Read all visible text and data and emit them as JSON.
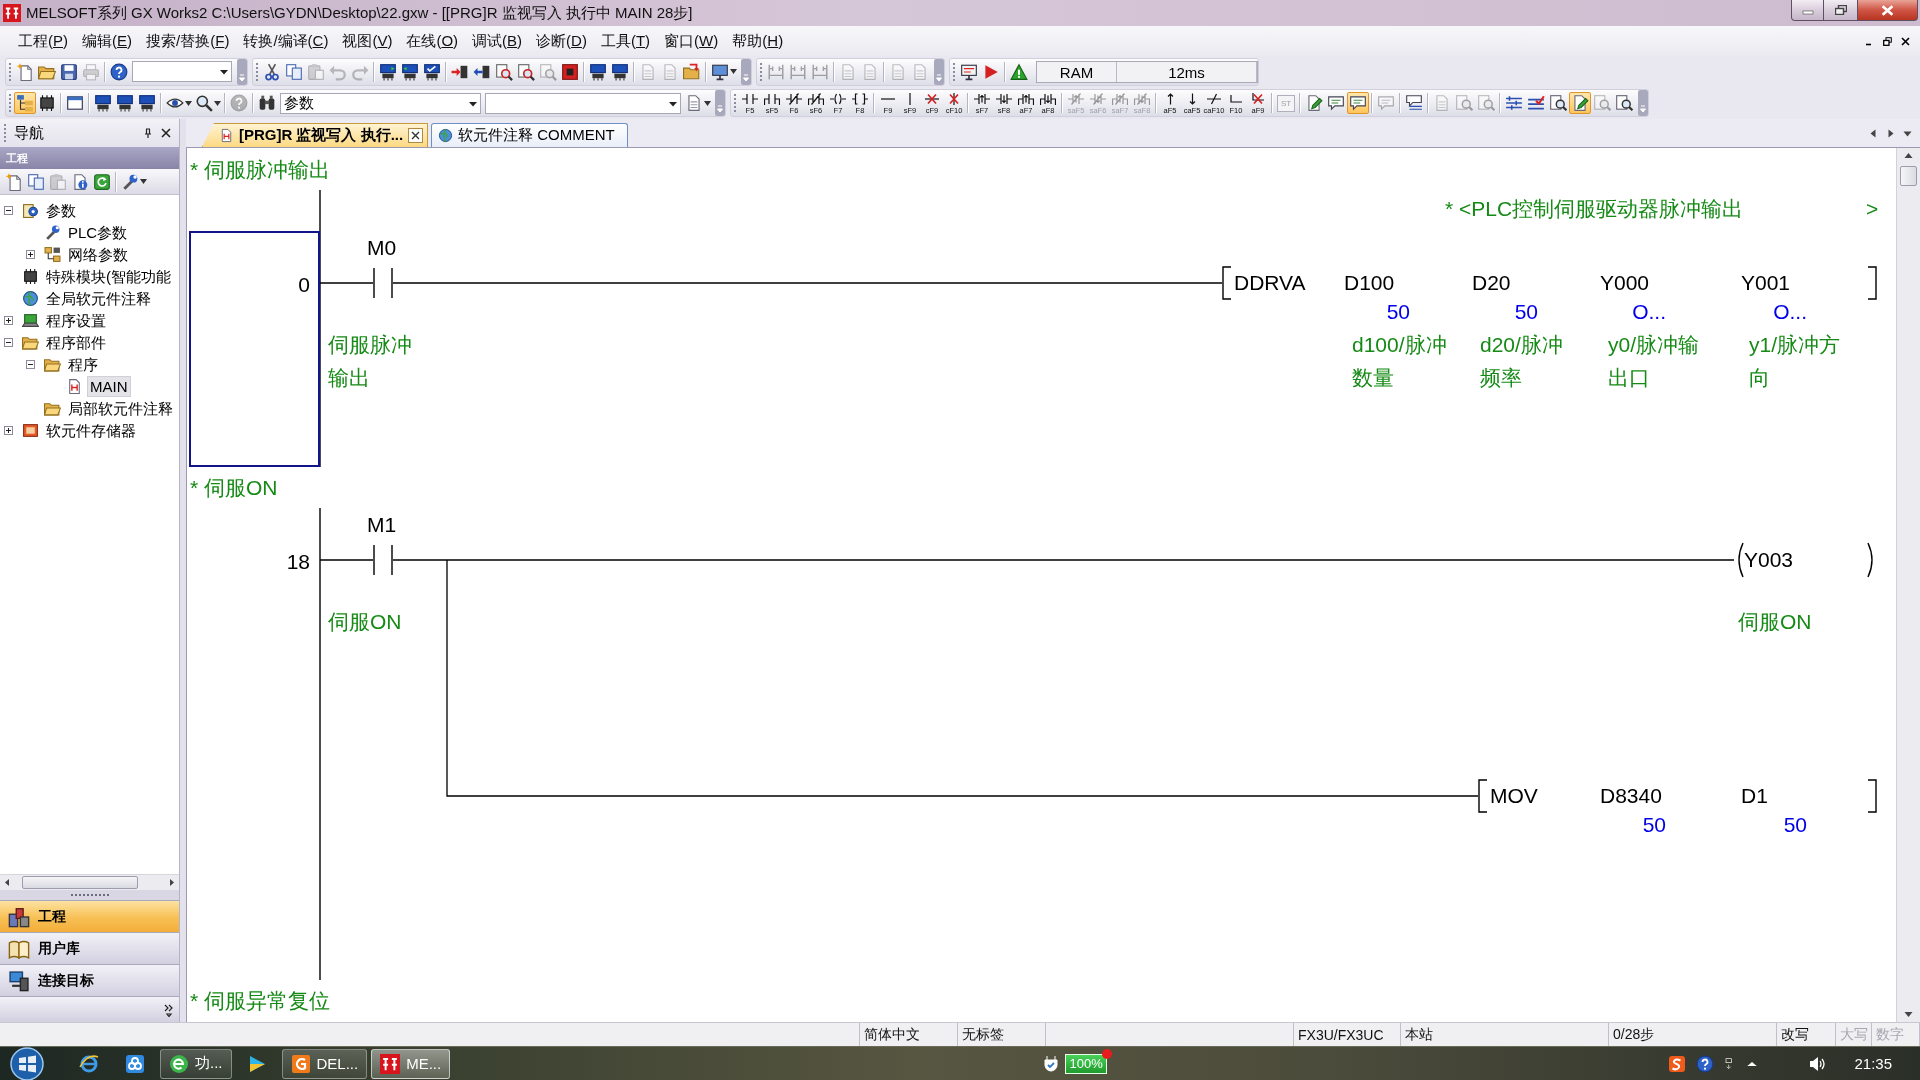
{
  "window": {
    "title": "MELSOFT系列 GX Works2 C:\\Users\\GYDN\\Desktop\\22.gxw - [[PRG]R 监视写入 执行中 MAIN 28步]"
  },
  "menu": [
    "工程(P)",
    "编辑(E)",
    "搜索/替换(F)",
    "转换/编译(C)",
    "视图(V)",
    "在线(O)",
    "调试(B)",
    "诊断(D)",
    "工具(T)",
    "窗口(W)",
    "帮助(H)"
  ],
  "toolbar_top": [
    {
      "items": [
        {
          "kind": "new",
          "disabled": false,
          "on": false
        },
        {
          "kind": "open",
          "disabled": false,
          "on": false
        },
        {
          "kind": "save",
          "disabled": false,
          "on": false
        },
        {
          "kind": "print",
          "disabled": true,
          "on": false
        },
        {
          "kind": "sep"
        },
        {
          "kind": "help",
          "disabled": false,
          "on": false
        },
        {
          "kind": "combo"
        }
      ]
    },
    {
      "items": [
        {
          "kind": "cut",
          "disabled": false,
          "on": false
        },
        {
          "kind": "copy",
          "disabled": false,
          "on": false
        },
        {
          "kind": "paste",
          "disabled": true,
          "on": false
        },
        {
          "kind": "undo",
          "disabled": true,
          "on": false
        },
        {
          "kind": "redo",
          "disabled": true,
          "on": false
        },
        {
          "kind": "sep"
        },
        {
          "kind": "chip_in",
          "disabled": false,
          "on": false
        },
        {
          "kind": "chip_out",
          "disabled": false,
          "on": false
        },
        {
          "kind": "chip_check",
          "disabled": false,
          "on": false
        },
        {
          "kind": "sep"
        },
        {
          "kind": "write",
          "disabled": false,
          "on": false
        },
        {
          "kind": "read",
          "disabled": false,
          "on": false
        },
        {
          "kind": "verify",
          "disabled": false,
          "on": false
        },
        {
          "kind": "verify",
          "disabled": false,
          "on": false
        },
        {
          "kind": "verify",
          "disabled": true,
          "on": false
        },
        {
          "kind": "stop",
          "disabled": false,
          "on": false
        },
        {
          "kind": "sep"
        },
        {
          "kind": "chip",
          "disabled": false,
          "on": false
        },
        {
          "kind": "chip",
          "disabled": false,
          "on": false
        },
        {
          "kind": "sep"
        },
        {
          "kind": "doc",
          "disabled": true,
          "on": false
        },
        {
          "kind": "doc",
          "disabled": true,
          "on": false
        },
        {
          "kind": "folder_arrow",
          "disabled": false,
          "on": false
        },
        {
          "kind": "sep"
        },
        {
          "kind": "monitor",
          "disabled": false,
          "on": false,
          "dropdown": true
        }
      ]
    },
    {
      "items": [
        {
          "kind": "ladder",
          "disabled": true,
          "on": false
        },
        {
          "kind": "ladder",
          "disabled": true,
          "on": false
        },
        {
          "kind": "ladder",
          "disabled": true,
          "on": false
        },
        {
          "kind": "sep"
        },
        {
          "kind": "doc",
          "disabled": true,
          "on": false
        },
        {
          "kind": "doc",
          "disabled": true,
          "on": false
        },
        {
          "kind": "sep"
        },
        {
          "kind": "doc",
          "disabled": true,
          "on": false
        },
        {
          "kind": "doc",
          "disabled": true,
          "on": false
        }
      ]
    },
    {
      "items": [
        {
          "kind": "monitor_run",
          "disabled": false,
          "on": false
        },
        {
          "kind": "run",
          "disabled": false,
          "on": false
        },
        {
          "kind": "sep"
        },
        {
          "kind": "warn",
          "disabled": false,
          "on": false
        },
        {
          "kind": "readout",
          "cells": [
            "RAM",
            "12ms"
          ]
        }
      ]
    }
  ],
  "toolbar_bottom": [
    {
      "items": [
        {
          "kind": "tree",
          "disabled": false,
          "on": true
        },
        {
          "kind": "module",
          "disabled": false,
          "on": false
        },
        {
          "kind": "sep"
        },
        {
          "kind": "window",
          "disabled": false,
          "on": false
        },
        {
          "kind": "sep"
        },
        {
          "kind": "chip",
          "disabled": false,
          "on": false
        },
        {
          "kind": "chip",
          "disabled": false,
          "on": false
        },
        {
          "kind": "chip",
          "disabled": false,
          "on": false
        },
        {
          "kind": "sep"
        },
        {
          "kind": "eye",
          "disabled": false,
          "on": false,
          "dropdown": true
        },
        {
          "kind": "zoom_tool",
          "disabled": false,
          "on": false,
          "dropdown": true
        },
        {
          "kind": "sep"
        },
        {
          "kind": "help",
          "disabled": true,
          "on": false
        },
        {
          "kind": "sep"
        },
        {
          "kind": "binoculars",
          "disabled": false,
          "on": false
        },
        {
          "kind": "combo",
          "value": "参数"
        },
        {
          "kind": "combo"
        },
        {
          "kind": "doc",
          "disabled": false,
          "on": false,
          "dropdown": true
        }
      ]
    },
    {
      "items": [
        {
          "kind": "contact",
          "key": "F5",
          "disabled": false,
          "on": false
        },
        {
          "kind": "contact_parallel",
          "key": "sF5",
          "disabled": false,
          "on": false
        },
        {
          "kind": "contact_nc",
          "key": "F6",
          "disabled": false,
          "on": false
        },
        {
          "kind": "contact_nc_parallel",
          "key": "sF6",
          "disabled": false,
          "on": false
        },
        {
          "kind": "coil",
          "key": "F7",
          "disabled": false,
          "on": false
        },
        {
          "kind": "instruction",
          "key": "F8",
          "disabled": false,
          "on": false
        },
        {
          "kind": "sep"
        },
        {
          "kind": "line_h",
          "key": "F9",
          "disabled": false,
          "on": false
        },
        {
          "kind": "line_v",
          "key": "sF9",
          "disabled": false,
          "on": false
        },
        {
          "kind": "delete_h",
          "key": "cF9",
          "disabled": false,
          "on": false
        },
        {
          "kind": "delete_v",
          "key": "cF10",
          "disabled": false,
          "on": false
        },
        {
          "kind": "sep"
        },
        {
          "kind": "rising",
          "key": "sF7",
          "disabled": false,
          "on": false
        },
        {
          "kind": "falling",
          "key": "sF8",
          "disabled": false,
          "on": false
        },
        {
          "kind": "rising_parallel",
          "key": "aF7",
          "disabled": false,
          "on": false
        },
        {
          "kind": "falling_parallel",
          "key": "aF8",
          "disabled": false,
          "on": false
        },
        {
          "kind": "sep"
        },
        {
          "kind": "rising_nc",
          "key": "saF5",
          "disabled": true,
          "on": false
        },
        {
          "kind": "falling_nc",
          "key": "saF6",
          "disabled": true,
          "on": false
        },
        {
          "kind": "rising_nc_parallel",
          "key": "saF7",
          "disabled": true,
          "on": false
        },
        {
          "kind": "falling_nc_parallel",
          "key": "saF8",
          "disabled": true,
          "on": false
        },
        {
          "kind": "sep"
        },
        {
          "kind": "pulse_up",
          "key": "aF5",
          "disabled": false,
          "on": false
        },
        {
          "kind": "pulse_down",
          "key": "caF5",
          "disabled": false,
          "on": false
        },
        {
          "kind": "invert",
          "key": "caF10",
          "disabled": false,
          "on": false
        },
        {
          "kind": "line_draw",
          "key": "F10",
          "disabled": false,
          "on": false
        },
        {
          "kind": "line_erase",
          "key": "aF9",
          "disabled": false,
          "on": false
        },
        {
          "kind": "sep"
        },
        {
          "kind": "framed",
          "key": "ST",
          "disabled": true,
          "on": false
        },
        {
          "kind": "sep"
        },
        {
          "kind": "pencil",
          "disabled": false,
          "on": false
        },
        {
          "kind": "bubble",
          "disabled": false,
          "on": false
        },
        {
          "kind": "bubble",
          "disabled": false,
          "on": true
        },
        {
          "kind": "sep"
        },
        {
          "kind": "bubble",
          "disabled": true,
          "on": false
        },
        {
          "kind": "sep"
        },
        {
          "kind": "bubble_list",
          "disabled": false,
          "on": false
        },
        {
          "kind": "sep"
        },
        {
          "kind": "doc",
          "disabled": true,
          "on": false
        },
        {
          "kind": "zoom",
          "disabled": true,
          "on": false
        },
        {
          "kind": "zoom",
          "disabled": true,
          "on": false
        },
        {
          "kind": "sep"
        },
        {
          "kind": "lines",
          "disabled": false,
          "on": false
        },
        {
          "kind": "lines_check",
          "disabled": false,
          "on": false
        },
        {
          "kind": "zoom",
          "disabled": false,
          "on": false
        },
        {
          "kind": "pencil",
          "disabled": false,
          "on": true
        },
        {
          "kind": "zoom",
          "disabled": true,
          "on": false
        },
        {
          "kind": "zoom",
          "disabled": false,
          "on": false
        }
      ]
    }
  ],
  "navigation": {
    "title": "导航",
    "section": "工程",
    "toolbar": [
      {
        "kind": "new",
        "disabled": false,
        "on": false
      },
      {
        "kind": "copy",
        "disabled": false,
        "on": false
      },
      {
        "kind": "paste",
        "disabled": true,
        "on": false
      },
      {
        "kind": "info",
        "disabled": false,
        "on": false
      },
      {
        "kind": "refresh",
        "disabled": false,
        "on": false
      },
      {
        "kind": "sep"
      },
      {
        "kind": "wrench",
        "disabled": false,
        "on": false,
        "dropdown": true
      }
    ],
    "tree": [
      {
        "label": "参数",
        "kind": "gear",
        "expanded": true,
        "selected": false,
        "children": [
          {
            "label": "PLC参数",
            "kind": "wrench",
            "selected": false
          },
          {
            "label": "网络参数",
            "kind": "network",
            "expanded": false,
            "selected": false
          }
        ]
      },
      {
        "label": "特殊模块(智能功能",
        "kind": "module",
        "selected": false
      },
      {
        "label": "全局软元件注释",
        "kind": "globe",
        "selected": false
      },
      {
        "label": "程序设置",
        "kind": "laptop",
        "expanded": false,
        "selected": false
      },
      {
        "label": "程序部件",
        "kind": "open",
        "expanded": true,
        "selected": false,
        "children": [
          {
            "label": "程序",
            "kind": "open",
            "expanded": true,
            "selected": false,
            "children": [
              {
                "label": "MAIN",
                "kind": "program",
                "selected": true
              }
            ]
          },
          {
            "label": "局部软元件注释",
            "kind": "open",
            "selected": false
          }
        ]
      },
      {
        "label": "软元件存储器",
        "kind": "memory",
        "expanded": false,
        "selected": false
      }
    ],
    "panes": [
      {
        "label": "工程",
        "kind": "project",
        "selected": true
      },
      {
        "label": "用户库",
        "kind": "library",
        "selected": false
      },
      {
        "label": "连接目标",
        "kind": "target",
        "selected": false
      }
    ]
  },
  "tabs": [
    {
      "label": "[PRG]R 监视写入 执行...",
      "kind": "program",
      "selected": true
    },
    {
      "label": "软元件注释 COMMENT",
      "kind": "globe",
      "selected": false
    }
  ],
  "editor": {
    "rungs": [
      {
        "comment": "* 伺服脉冲输出",
        "step": "0",
        "selected": true,
        "note": "* <PLC控制伺服驱动器脉冲输出",
        "note_end": ">",
        "contacts": [
          {
            "device": "M0",
            "comment": "伺服脉冲输出"
          }
        ],
        "outputs": [
          {
            "kind": "instruction",
            "mnemonic": "DDRVA",
            "operands": [
              {
                "device": "D100",
                "value": "50",
                "comment": "d100/脉冲数量"
              },
              {
                "device": "D20",
                "value": "50",
                "comment": "d20/脉冲频率"
              },
              {
                "device": "Y000",
                "value": "O...",
                "comment": "y0/脉冲输出口"
              },
              {
                "device": "Y001",
                "value": "O...",
                "comment": "y1/脉冲方向"
              }
            ]
          }
        ]
      },
      {
        "comment": "* 伺服ON",
        "step": "18",
        "selected": false,
        "contacts": [
          {
            "device": "M1",
            "comment": "伺服ON"
          }
        ],
        "outputs": [
          {
            "kind": "coil",
            "device": "Y003",
            "comment": "伺服ON"
          },
          {
            "kind": "instruction",
            "mnemonic": "MOV",
            "operands": [
              {
                "device": "D8340",
                "value": "50"
              },
              {
                "device": "D1",
                "value": "50"
              }
            ]
          }
        ]
      },
      {
        "comment": "* 伺服异常复位"
      }
    ]
  },
  "status_bar": {
    "language": "简体中文",
    "label": "无标签",
    "cpu": "FX3U/FX3UC",
    "station": "本站",
    "steps": "0/28步",
    "indicators": [
      {
        "label": "改写",
        "on": true
      },
      {
        "label": "大写",
        "on": false
      },
      {
        "label": "数字",
        "on": false
      }
    ]
  },
  "taskbar": {
    "items": [
      {
        "kind": "ie",
        "selected": false
      },
      {
        "kind": "cloud",
        "selected": false
      },
      {
        "kind": "green_app",
        "label": "功...",
        "selected": false
      },
      {
        "kind": "player",
        "selected": false
      },
      {
        "kind": "orange_app",
        "label": "DEL...",
        "selected": false
      },
      {
        "kind": "melsoft",
        "label": "ME...",
        "selected": true
      }
    ],
    "battery": "100%",
    "clock": "21:35"
  }
}
